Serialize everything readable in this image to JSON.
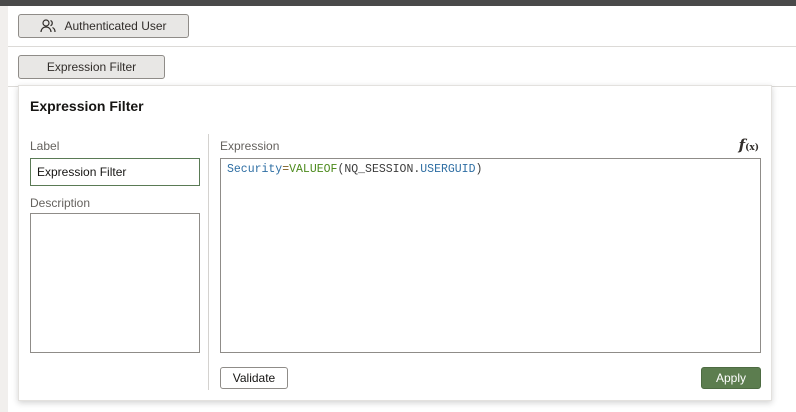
{
  "header": {
    "authenticated_user_label": "Authenticated User",
    "expression_filter_label": "Expression Filter"
  },
  "popup": {
    "title": "Expression Filter",
    "label_field": {
      "label": "Label",
      "value": "Expression Filter"
    },
    "description_field": {
      "label": "Description",
      "value": ""
    },
    "expression": {
      "label": "Expression",
      "function_icon": "function-fx-icon",
      "tokens": {
        "t1": "Security",
        "t2": "=",
        "t3": "VALUEOF",
        "t4": "(NQ_SESSION.",
        "t5": "USERGUID",
        "t6": ")"
      }
    },
    "validate_label": "Validate",
    "apply_label": "Apply"
  },
  "colors": {
    "apply_button": "#5c7d4f",
    "topbar": "#4a4a4a",
    "identifier": "#2e6ea3",
    "function": "#4c8a1c"
  }
}
